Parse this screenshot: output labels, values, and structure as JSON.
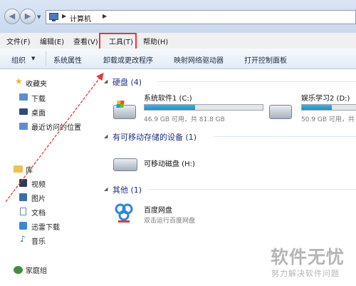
{
  "address": {
    "nav_back": "◀",
    "nav_forward": "▶",
    "dropdown": "▼",
    "crumb_sep": "▶",
    "path": "计算机",
    "crumb_end": "▶"
  },
  "menu": {
    "file": "文件(F)",
    "edit": "编辑(E)",
    "view": "查看(V)",
    "tools": "工具(T)",
    "help": "帮助(H)"
  },
  "toolbar": {
    "organize": "组织",
    "organize_arrow": "▼",
    "system_properties": "系统属性",
    "uninstall": "卸载或更改程序",
    "map_drive": "映射网络驱动器",
    "control_panel": "打开控制面板"
  },
  "sidebar": {
    "favorites": "收藏夹",
    "downloads": "下载",
    "desktop": "桌面",
    "recent": "最近访问的位置",
    "libraries": "库",
    "videos": "视频",
    "pictures": "图片",
    "documents": "文档",
    "thunder_downloads": "迅雷下载",
    "music": "音乐",
    "homegroup": "家庭组",
    "star_icon": "★",
    "music_icon": "♪"
  },
  "sections": {
    "collapse_icon": "◢",
    "hard_disks": {
      "title": "硬盘 (4)"
    },
    "removable": {
      "title": "有可移动存储的设备 (1)"
    },
    "other": {
      "title": "其他 (1)"
    }
  },
  "drives": [
    {
      "name": "系统软件1 (C:)",
      "size": "46.9 GB 可用，共 81.8 GB",
      "used_fraction": 0.43
    },
    {
      "name": "娱乐学习2 (D:)",
      "size": "50.9 GB 可用，共",
      "used_fraction": 0.55
    }
  ],
  "removable_drive": {
    "name": "可移动磁盘 (H:)"
  },
  "other_app": {
    "name": "百度网盘",
    "desc": "双击运行百度网盘"
  },
  "watermark": {
    "main": "软件无忧",
    "sub": "努力解决软件问题"
  },
  "colors": {
    "highlight_box": "#e23b3b",
    "arrow": "#e23b3b",
    "section_header": "#1e3287",
    "drive_fill": "#26a0da"
  }
}
